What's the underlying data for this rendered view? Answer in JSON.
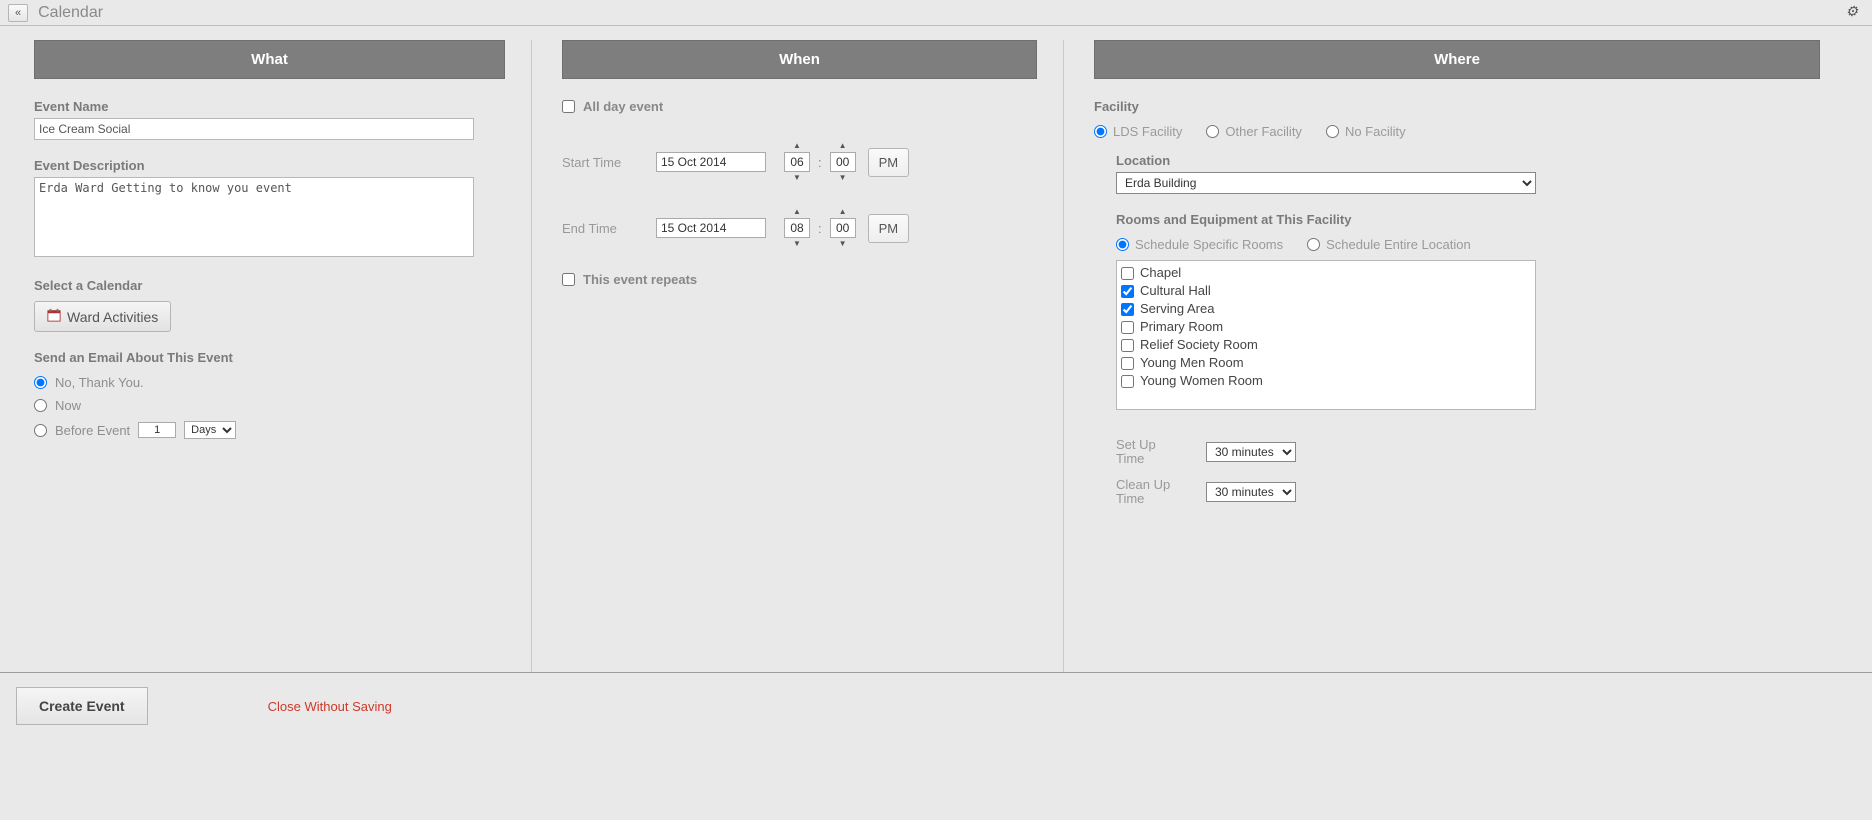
{
  "topbar": {
    "back": "«",
    "title": "Calendar",
    "settings_icon": "⚙"
  },
  "what": {
    "header": "What",
    "event_name_label": "Event Name",
    "event_name_value": "Ice Cream Social",
    "event_desc_label": "Event Description",
    "event_desc_value": "Erda Ward Getting to know you event",
    "select_calendar_label": "Select a Calendar",
    "calendar_name": "Ward Activities",
    "send_email_label": "Send an Email About This Event",
    "email_options": {
      "no": "No, Thank You.",
      "now": "Now",
      "before": "Before Event",
      "before_count": "1",
      "before_unit": "Days"
    }
  },
  "when": {
    "header": "When",
    "all_day_label": "All day event",
    "start_label": "Start Time",
    "end_label": "End Time",
    "start_date": "15 Oct 2014",
    "start_hour": "06",
    "start_min": "00",
    "start_ampm": "PM",
    "end_date": "15 Oct 2014",
    "end_hour": "08",
    "end_min": "00",
    "end_ampm": "PM",
    "repeats_label": "This event repeats"
  },
  "where": {
    "header": "Where",
    "facility_label": "Facility",
    "facility_options": {
      "lds": "LDS Facility",
      "other": "Other Facility",
      "none": "No Facility"
    },
    "location_label": "Location",
    "location_value": "Erda Building",
    "rooms_label": "Rooms and Equipment at This Facility",
    "schedule_options": {
      "specific": "Schedule Specific Rooms",
      "entire": "Schedule Entire Location"
    },
    "rooms": [
      {
        "name": "Chapel",
        "checked": false
      },
      {
        "name": "Cultural Hall",
        "checked": true
      },
      {
        "name": "Serving Area",
        "checked": true
      },
      {
        "name": "Primary Room",
        "checked": false
      },
      {
        "name": "Relief Society Room",
        "checked": false
      },
      {
        "name": "Young Men Room",
        "checked": false
      },
      {
        "name": "Young Women Room",
        "checked": false
      }
    ],
    "setup_label": "Set Up Time",
    "setup_value": "30 minutes",
    "cleanup_label": "Clean Up Time",
    "cleanup_value": "30 minutes"
  },
  "footer": {
    "create": "Create Event",
    "cancel": "Close Without Saving"
  }
}
